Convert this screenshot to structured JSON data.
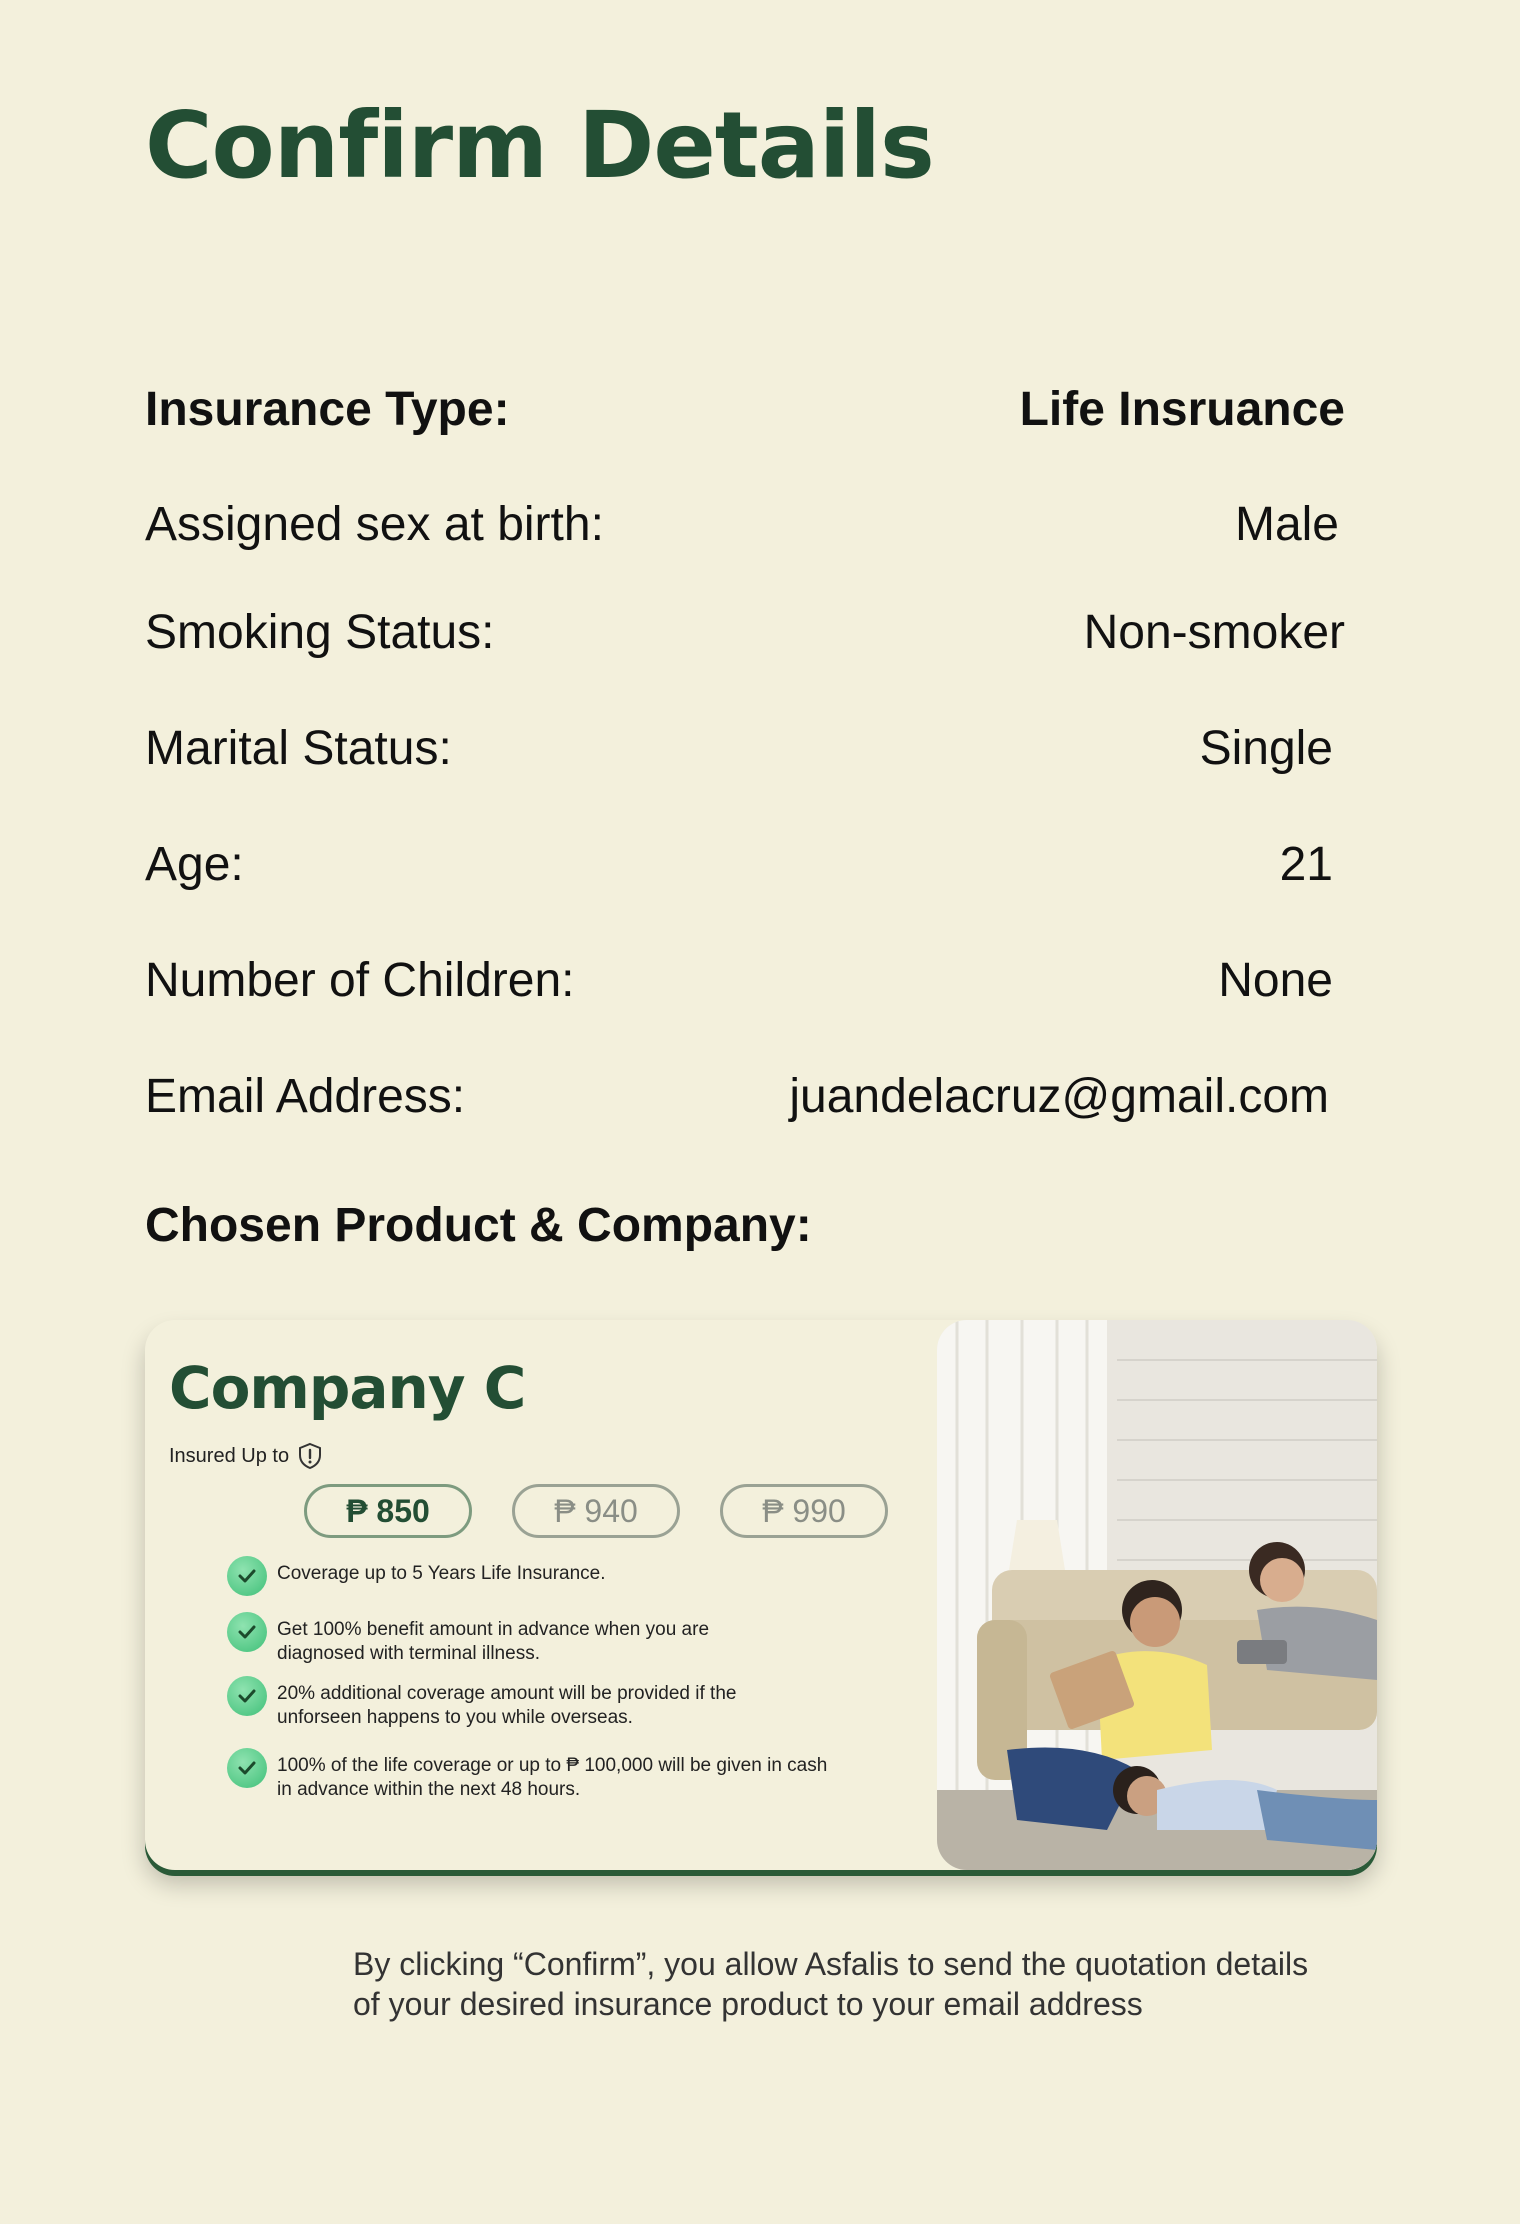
{
  "page": {
    "title": "Confirm Details"
  },
  "details": [
    {
      "label": "Insurance Type:",
      "value": "Life Insruance"
    },
    {
      "label": "Assigned sex at birth:",
      "value": "Male"
    },
    {
      "label": "Smoking Status:",
      "value": "Non-smoker"
    },
    {
      "label": "Marital Status:",
      "value": "Single"
    },
    {
      "label": "Age:",
      "value": "21"
    },
    {
      "label": "Number of Children:",
      "value": "None"
    },
    {
      "label": "Email Address:",
      "value": "juandelacruz@gmail.com"
    }
  ],
  "section": {
    "chosen_label": "Chosen Product & Company:"
  },
  "card": {
    "company": "Company C",
    "insured_label": "Insured Up to",
    "insured_icon": "shield-alert-icon",
    "pills": [
      {
        "label": "₱ 850",
        "selected": true
      },
      {
        "label": "₱ 940",
        "selected": false
      },
      {
        "label": "₱ 990",
        "selected": false
      }
    ],
    "features": [
      "Coverage up to 5 Years Life Insurance.",
      "Get 100% benefit amount in advance when you are diagnosed with terminal illness.",
      "20% additional coverage amount will be provided if the unforseen happens to you while overseas.",
      "100% of the life coverage or up to ₱ 100,000 will be given in cash in advance within the next 48 hours."
    ],
    "feature_icon": "check-circle-icon",
    "photo": "family-photo"
  },
  "consent": "By clicking “Confirm”, you allow Asfalis to send the quotation details of your desired insurance product to your email address",
  "colors": {
    "background": "#f3f0dc",
    "brand_green": "#234e34",
    "check_green": "#3fbf78"
  }
}
